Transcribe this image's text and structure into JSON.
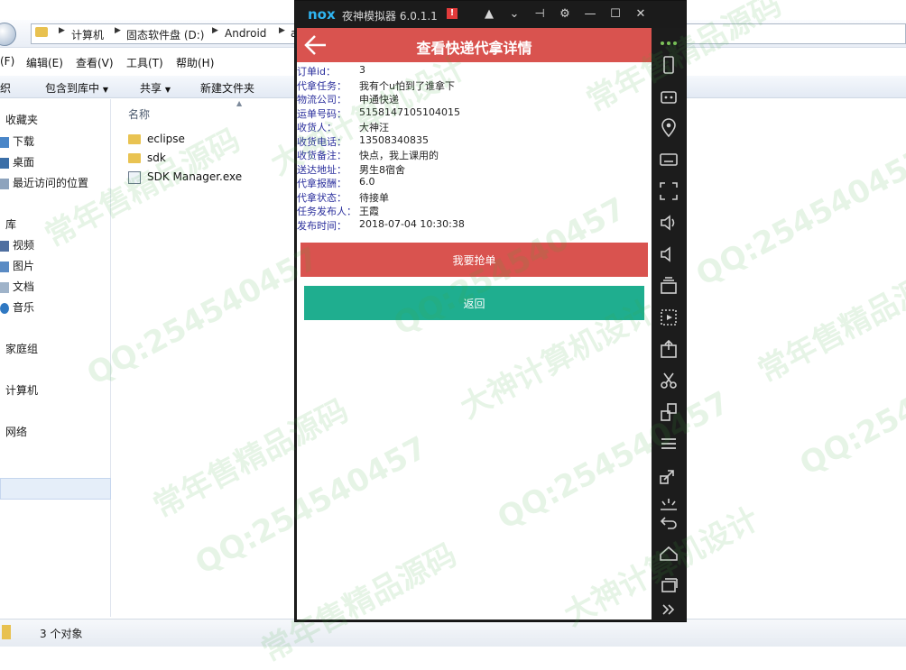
{
  "explorer": {
    "breadcrumbs": [
      "计算机",
      "固态软件盘 (D:)",
      "Android",
      "a"
    ],
    "menu": [
      "(F)",
      "编辑(E)",
      "查看(V)",
      "工具(T)",
      "帮助(H)"
    ],
    "commands": [
      "织",
      "包含到库中",
      "共享",
      "新建文件夹"
    ],
    "nav": {
      "favorites": "收藏夹",
      "downloads": "下载",
      "desktop": "桌面",
      "recent": "最近访问的位置",
      "libraries": "库",
      "videos": "视频",
      "pictures": "图片",
      "documents": "文档",
      "music": "音乐",
      "homegroup": "家庭组",
      "computer": "计算机",
      "network": "网络"
    },
    "column_name": "名称",
    "files": [
      "eclipse",
      "sdk",
      "SDK Manager.exe"
    ],
    "status": "3 个对象"
  },
  "nox": {
    "logo": "nox",
    "title": "夜神模拟器 6.0.1.1",
    "warn": "!"
  },
  "app": {
    "title": "查看快递代拿详情",
    "details": [
      {
        "label": "订单id：",
        "value": "3"
      },
      {
        "label": "代拿任务：",
        "value": "我有个u怕到了谁拿下"
      },
      {
        "label": "物流公司：",
        "value": "申通快递"
      },
      {
        "label": "运单号码：",
        "value": "5158147105104015"
      },
      {
        "label": "收货人：",
        "value": "大神汪"
      },
      {
        "label": "收货电话：",
        "value": "13508340835"
      },
      {
        "label": "收货备注：",
        "value": "快点，我上课用的"
      },
      {
        "label": "送达地址：",
        "value": "男生8宿舍"
      },
      {
        "label": "代拿报酬：",
        "value": "6.0"
      },
      {
        "label": "代拿状态：",
        "value": "待接单"
      },
      {
        "label": "任务发布人：",
        "value": "王霞"
      },
      {
        "label": "发布时间：",
        "value": "2018-07-04 10:30:38"
      }
    ],
    "grab_button": "我要抢单",
    "return_button": "返回"
  },
  "colors": {
    "app_bar": "#d9534f",
    "grab_button": "#d9534f",
    "return_button": "#1fae8f",
    "label_text": "#2a2e9c"
  },
  "watermarks": [
    "常年售精品源码",
    "QQ:254540457",
    "大神计算机设计"
  ]
}
